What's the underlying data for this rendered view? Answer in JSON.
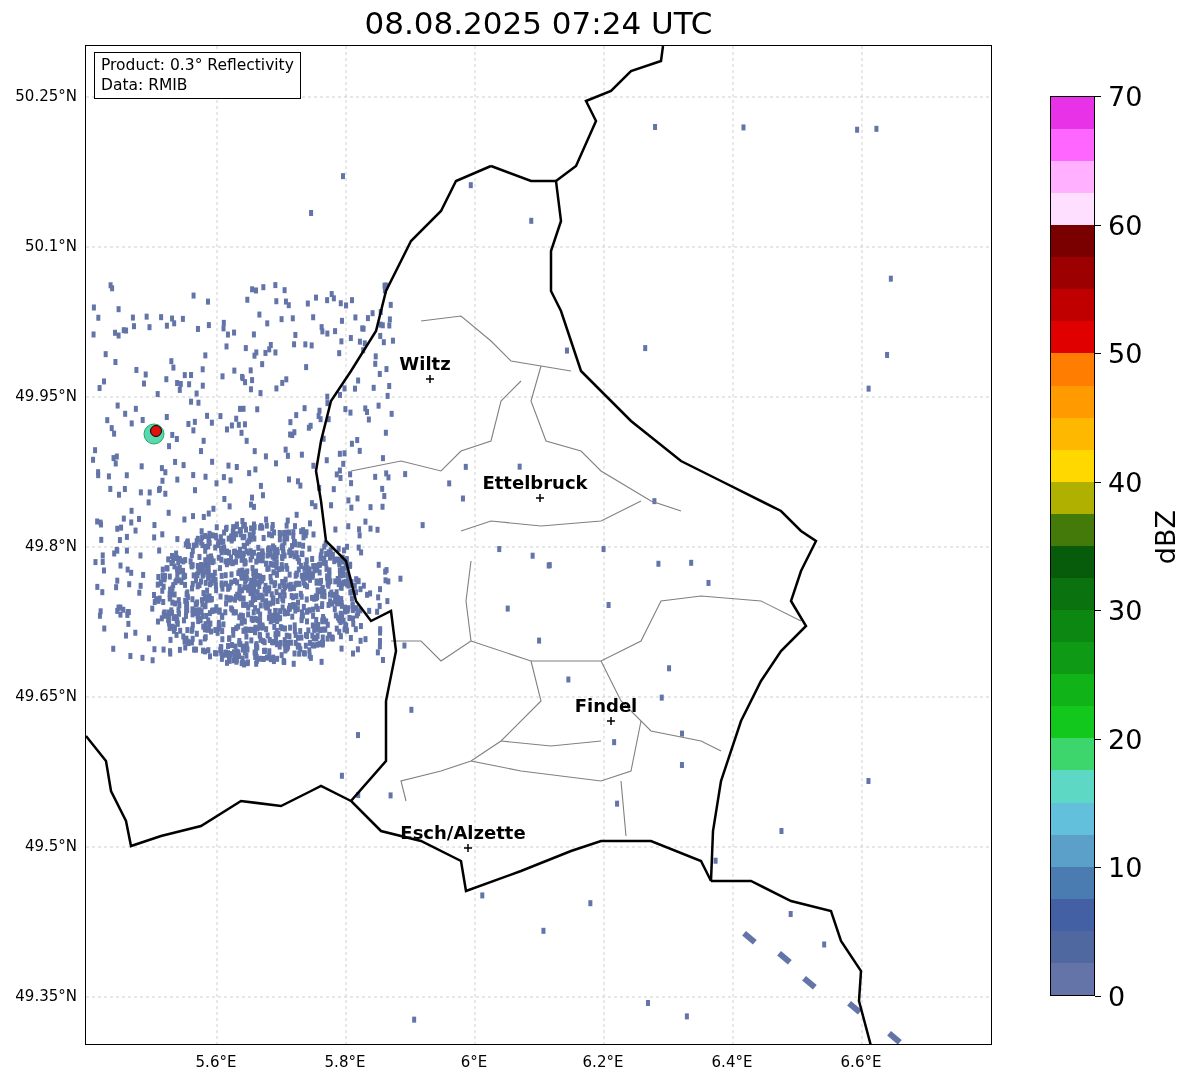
{
  "title": "08.08.2025 07:24 UTC",
  "info_box": [
    "Product: 0.3° Reflectivity",
    "Data: RMIB"
  ],
  "cities": [
    "Wiltz",
    "Ettelbruck",
    "Findel",
    "Esch/Alzette"
  ],
  "x_ticks": [
    "5.6°E",
    "5.8°E",
    "6°E",
    "6.2°E",
    "6.4°E",
    "6.6°E"
  ],
  "y_ticks": [
    "50.25°N",
    "50.1°N",
    "49.95°N",
    "49.8°N",
    "49.65°N",
    "49.5°N",
    "49.35°N"
  ],
  "colorbar": {
    "label": "dBZ",
    "ticks": [
      "70",
      "60",
      "50",
      "40",
      "30",
      "20",
      "10",
      "0"
    ],
    "segments": [
      {
        "color": "#6474a8"
      },
      {
        "color": "#5068a0"
      },
      {
        "color": "#4460a4"
      },
      {
        "color": "#4a7cb2"
      },
      {
        "color": "#5aa0c8"
      },
      {
        "color": "#62c0dc"
      },
      {
        "color": "#5cd8c4"
      },
      {
        "color": "#3cd66c"
      },
      {
        "color": "#12c81c"
      },
      {
        "color": "#10b418"
      },
      {
        "color": "#0e9a14"
      },
      {
        "color": "#0c8812"
      },
      {
        "color": "#0a720f"
      },
      {
        "color": "#065c0a"
      },
      {
        "color": "#447a0a"
      },
      {
        "color": "#b0b000"
      },
      {
        "color": "#ffd800"
      },
      {
        "color": "#ffb800"
      },
      {
        "color": "#ff9a00"
      },
      {
        "color": "#ff7d00"
      },
      {
        "color": "#e00000"
      },
      {
        "color": "#c00000"
      },
      {
        "color": "#9c0000"
      },
      {
        "color": "#7a0000"
      },
      {
        "color": "#ffdfff"
      },
      {
        "color": "#ffb0ff"
      },
      {
        "color": "#ff66ff"
      },
      {
        "color": "#e832e8"
      }
    ]
  }
}
